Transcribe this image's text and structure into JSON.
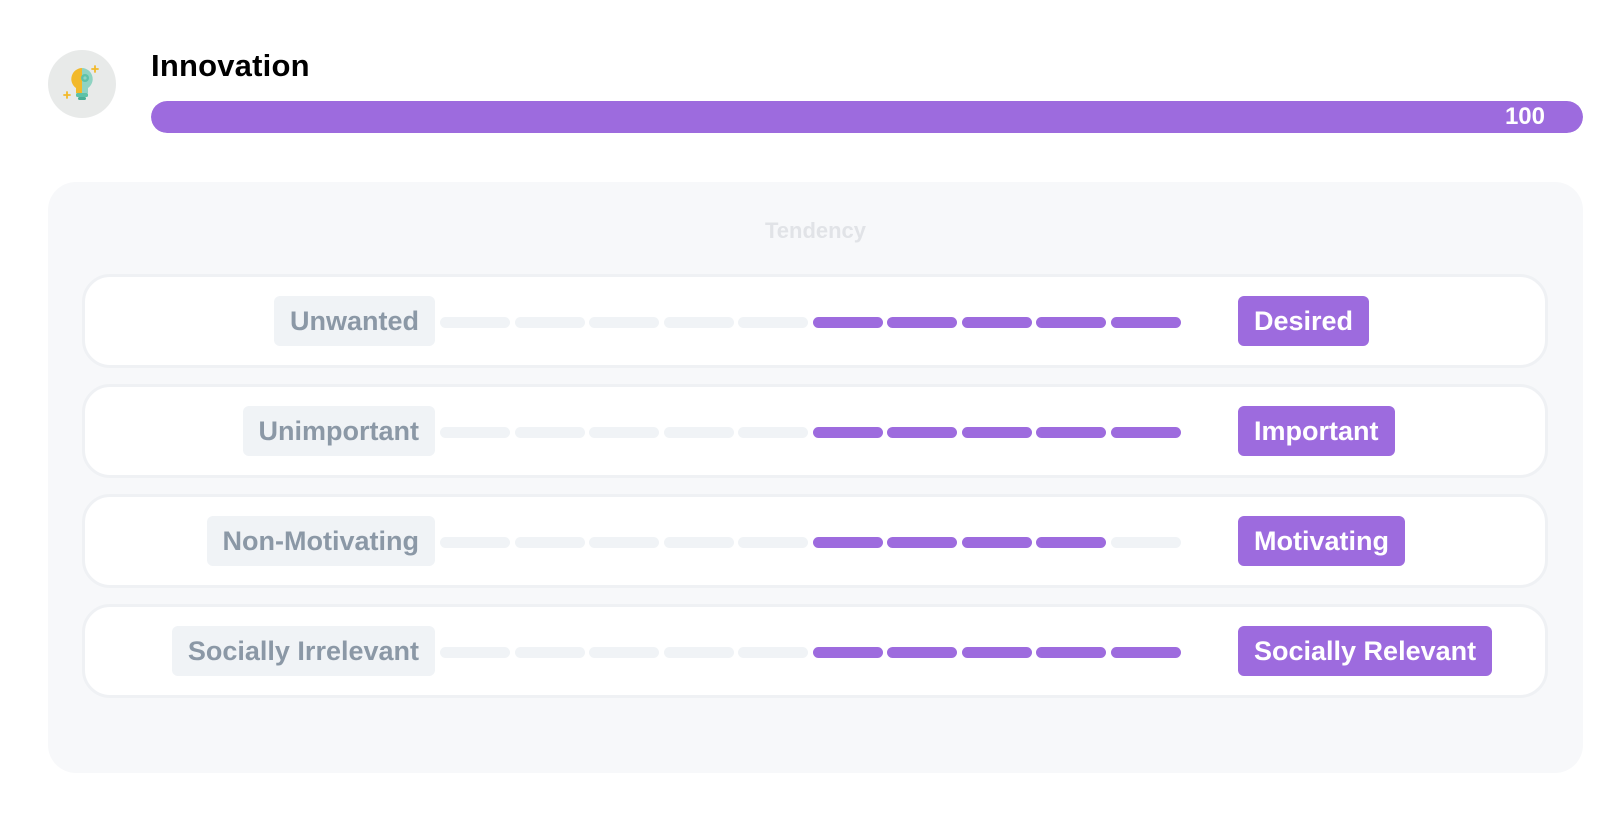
{
  "header": {
    "icon": "lightbulb-gear-icon",
    "title": "Innovation",
    "score": 100,
    "score_max": 100,
    "score_label": "100"
  },
  "colors": {
    "accent": "#9d6bde",
    "inactive": "#f0f3f6",
    "muted_text": "#8b98a6"
  },
  "tendency": {
    "title": "Tendency",
    "scale_steps": 10,
    "rows": [
      {
        "left": "Unwanted",
        "right": "Desired",
        "filled_from": 6,
        "filled_to": 10
      },
      {
        "left": "Unimportant",
        "right": "Important",
        "filled_from": 6,
        "filled_to": 10
      },
      {
        "left": "Non-Motivating",
        "right": "Motivating",
        "filled_from": 6,
        "filled_to": 9
      },
      {
        "left": "Socially Irrelevant",
        "right": "Socially Relevant",
        "filled_from": 6,
        "filled_to": 10
      }
    ]
  }
}
